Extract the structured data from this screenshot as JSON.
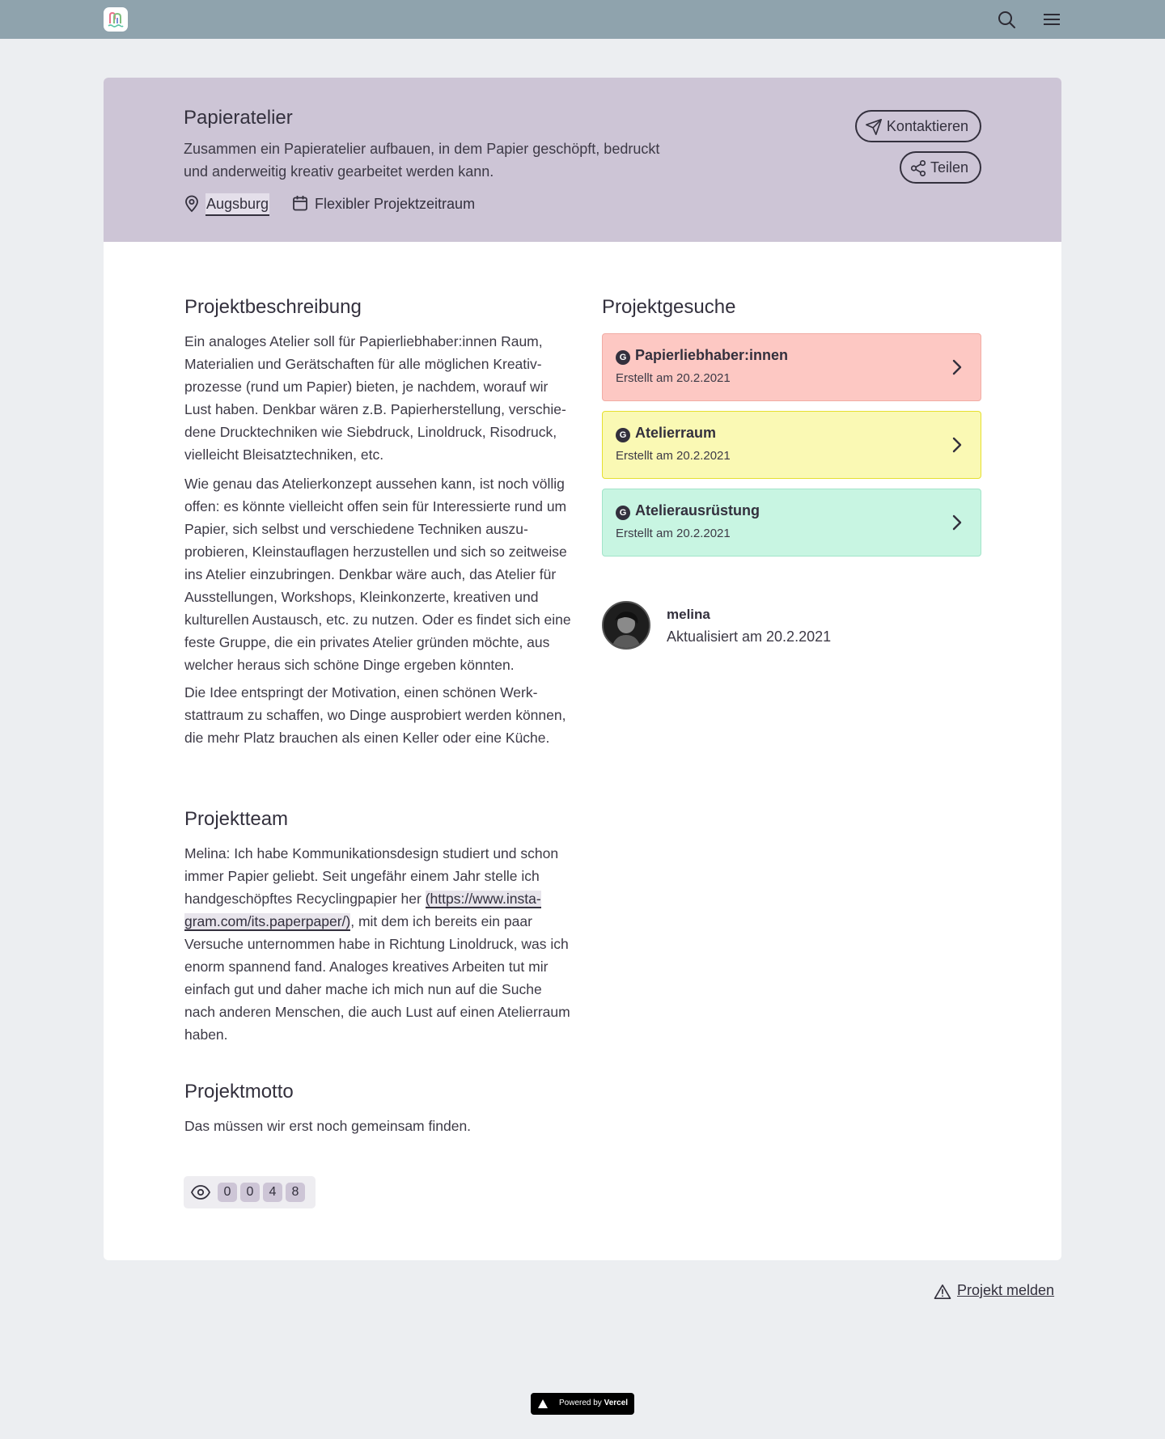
{
  "header": {
    "logo_icon": "app-logo",
    "search_icon": "search-icon",
    "menu_icon": "hamburger-menu-icon"
  },
  "project": {
    "title": "Papieratelier",
    "subtitle": "Zusammen ein Papieratelier aufbauen, in dem Papier geschöpft, bedruckt und anderweitig kreativ gearbeitet werden kann.",
    "location": "Augsburg",
    "timeframe": "Flexibler Projektzeitraum",
    "contact_label": "Kontaktieren",
    "share_label": "Teilen"
  },
  "description": {
    "heading": "Projektbeschreibung",
    "p1": "Ein analoges Atelier soll für Papierliebhaber:innen Raum, Materialien und Gerätschaften für alle möglichen Kreativ­prozesse (rund um Papier) bieten, je nachdem, worauf wir Lust haben. Denkbar wären z.B. Papierherstellung, verschie­dene Drucktechniken wie Siebdruck, Linoldruck, Risodruck, vielleicht Bleisatztechniken, etc.",
    "p2": "Wie genau das Atelierkonzept aussehen kann, ist noch völlig offen: es könnte vielleicht offen sein für Interessierte rund um Papier, sich selbst und verschiedene Techniken auszu­probieren, Kleinstauflagen herzustellen und sich so zeitwei­se ins Atelier einzubringen. Denkbar wäre auch, das Atelier für Ausstellungen, Workshops, Kleinkonzerte, kreativen und kulturellen Austausch, etc. zu nutzen. Oder es findet sich ei­ne feste Gruppe, die ein privates Atelier gründen möchte, aus welcher heraus sich schöne Dinge ergeben könnten.",
    "p3": "Die Idee entspringt der Motivation, einen schönen Werk­stattraum zu schaffen, wo Dinge ausprobiert werden kön­nen, die mehr Platz brauchen als einen Keller oder eine Kü­che."
  },
  "team": {
    "heading": "Projektteam",
    "text_before": "Melina: Ich habe Kommunikationsdesign studiert und schon immer Papier geliebt. Seit ungefähr einem Jahr stelle ich handgeschöpftes Recyclingpapier her ",
    "link": "(https://www.insta­gram.com/its.paperpaper/)",
    "text_after": ", mit dem ich bereits ein paar Versuche unternommen habe in Richtung Linoldruck, was ich enorm spannend fand. Analoges kreatives Arbeiten tut mir einfach gut und daher mache ich mich nun auf die Suche nach anderen Menschen, die auch Lust auf einen Atelier­raum haben."
  },
  "motto": {
    "heading": "Projektmotto",
    "text": "Das müssen wir erst noch gemeinsam finden."
  },
  "views": {
    "icon": "eye-icon",
    "digits": [
      "0",
      "0",
      "4",
      "8"
    ]
  },
  "requests": {
    "heading": "Projektgesuche",
    "badge": "G",
    "items": [
      {
        "title": "Papierliebhaber:innen",
        "date": "Erstellt am 20.2.2021",
        "color": "#fdc8c3"
      },
      {
        "title": "Atelierraum",
        "date": "Erstellt am 20.2.2021",
        "color": "#faf9b4"
      },
      {
        "title": "Atelierausrüstung",
        "date": "Erstellt am 20.2.2021",
        "color": "#c8f5e2"
      }
    ]
  },
  "author": {
    "name": "melina",
    "updated": "Aktualisiert am 20.2.2021"
  },
  "footer": {
    "report_label": "Projekt melden",
    "vercel_prefix": "Powered by",
    "vercel_brand": "Vercel"
  },
  "colors": {
    "topbar": "#8fa3ad",
    "hero": "#cdc5d6",
    "text": "#33303d",
    "background": "#eceef1"
  }
}
